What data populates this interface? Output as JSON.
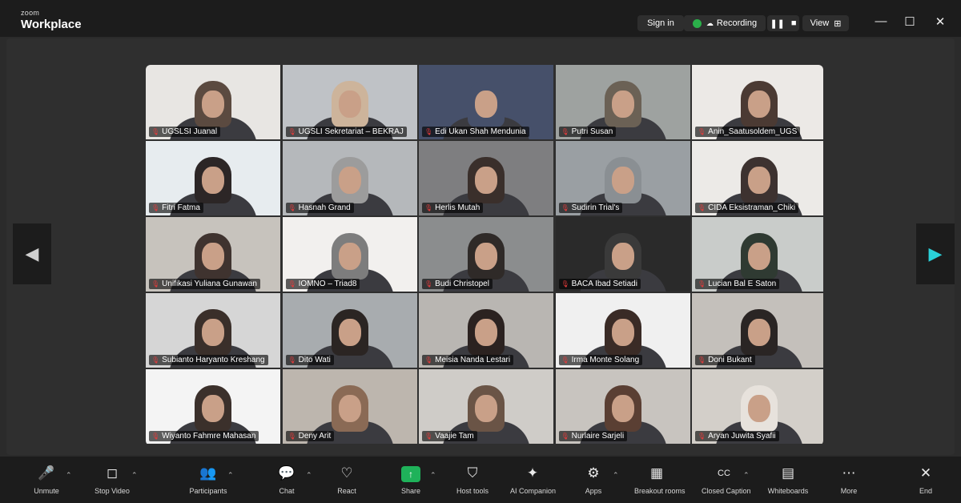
{
  "titlebar": {
    "brand_small": "zoom",
    "brand_big": "Workplace",
    "sign_in": "Sign in",
    "recording": "Recording",
    "view": "View"
  },
  "participants": [
    {
      "name": "UGSLSI Juanal",
      "bg": "#e8e6e3",
      "person": "#5b4a40"
    },
    {
      "name": "UGSLI Sekretariat – BEKRAJ",
      "bg": "#bfc2c6",
      "person": "#cdb49b"
    },
    {
      "name": "Edi Ukan Shah Mendunia",
      "bg": "#46506a",
      "person": "#46506a"
    },
    {
      "name": "Putri Susan",
      "bg": "#9ea2a0",
      "person": "#6b6155"
    },
    {
      "name": "Anin_Saatusoldem_UGS",
      "bg": "#ece9e6",
      "person": "#4b3a33"
    },
    {
      "name": "Fitri Fatma",
      "bg": "#e7ecef",
      "person": "#2c2626"
    },
    {
      "name": "Hasnah Grand",
      "bg": "#b5b8bb",
      "person": "#9c9c9c"
    },
    {
      "name": "Herlis Mutah",
      "bg": "#7e7e80",
      "person": "#3a2f2b"
    },
    {
      "name": "Sudirin Trial's",
      "bg": "#9a9fa3",
      "person": "#8a8f93"
    },
    {
      "name": "CIDA Eksistraman_Chiki",
      "bg": "#eceae7",
      "person": "#3d3230"
    },
    {
      "name": "Unifikasi Yuliana Gunawan",
      "bg": "#c7c3bd",
      "person": "#3f332f"
    },
    {
      "name": "IOMNO – Triad8",
      "bg": "#f2f0ee",
      "person": "#7d7d7d"
    },
    {
      "name": "Budi Christopel",
      "bg": "#8b8d8e",
      "person": "#2f2a28"
    },
    {
      "name": "BACA Ibad Setiadi",
      "bg": "#2a2a2a",
      "person": "#3a3a3a"
    },
    {
      "name": "Lucian Bal E Saton",
      "bg": "#c9ccca",
      "person": "#2f3a32"
    },
    {
      "name": "Subianto Haryanto Kreshang",
      "bg": "#d6d6d6",
      "person": "#3a2f2a"
    },
    {
      "name": "Dito Wati",
      "bg": "#a8acaf",
      "person": "#2b2523"
    },
    {
      "name": "Meisia Nanda Lestari",
      "bg": "#b9b6b2",
      "person": "#2b2220"
    },
    {
      "name": "Irma Monte Solang",
      "bg": "#f0f0f0",
      "person": "#3a2b26"
    },
    {
      "name": "Doni Bukant",
      "bg": "#c4c0bb",
      "person": "#2a2524"
    },
    {
      "name": "Wiyanto Fahmre Mahasan",
      "bg": "#f4f4f4",
      "person": "#3b302b"
    },
    {
      "name": "Deny Arit",
      "bg": "#bdb6ae",
      "person": "#8a6a55"
    },
    {
      "name": "Vaajie Tam",
      "bg": "#cfccc8",
      "person": "#6a5446"
    },
    {
      "name": "Nurlaire Sarjeli",
      "bg": "#c8c4bf",
      "person": "#5a3f33"
    },
    {
      "name": "Aryan Juwita Syafii",
      "bg": "#d3cfc9",
      "person": "#e7e2dc"
    }
  ],
  "toolbar": [
    {
      "label": "Unmute",
      "icon": "mic-muted-icon",
      "glyph": "🎤",
      "caret": true
    },
    {
      "label": "Stop Video",
      "icon": "video-camera-icon",
      "glyph": "◻",
      "caret": true
    },
    {
      "label": "Participants",
      "icon": "participants-icon",
      "glyph": "👥",
      "caret": true
    },
    {
      "label": "Chat",
      "icon": "chat-icon",
      "glyph": "💬",
      "caret": true
    },
    {
      "label": "React",
      "icon": "heart-icon",
      "glyph": "♡",
      "caret": false
    },
    {
      "label": "Share",
      "icon": "share-screen-icon",
      "glyph": "↑",
      "caret": true
    },
    {
      "label": "Host tools",
      "icon": "shield-icon",
      "glyph": "⛉",
      "caret": false
    },
    {
      "label": "AI Companion",
      "icon": "ai-sparkle-icon",
      "glyph": "✦",
      "caret": false
    },
    {
      "label": "Apps",
      "icon": "apps-icon",
      "glyph": "⚙",
      "caret": true
    },
    {
      "label": "Breakout rooms",
      "icon": "breakout-rooms-icon",
      "glyph": "▦",
      "caret": false
    },
    {
      "label": "Closed Caption",
      "icon": "closed-caption-icon",
      "glyph": "CC",
      "caret": true
    },
    {
      "label": "Whiteboards",
      "icon": "whiteboard-icon",
      "glyph": "▤",
      "caret": false
    },
    {
      "label": "More",
      "icon": "more-icon",
      "glyph": "⋯",
      "caret": false
    },
    {
      "label": "End",
      "icon": "end-icon",
      "glyph": "✕",
      "caret": false
    }
  ],
  "colors": {
    "recording_dot": "#2bb04a",
    "share_green": "#1fb25a",
    "next_arrow": "#2ad1d9"
  }
}
